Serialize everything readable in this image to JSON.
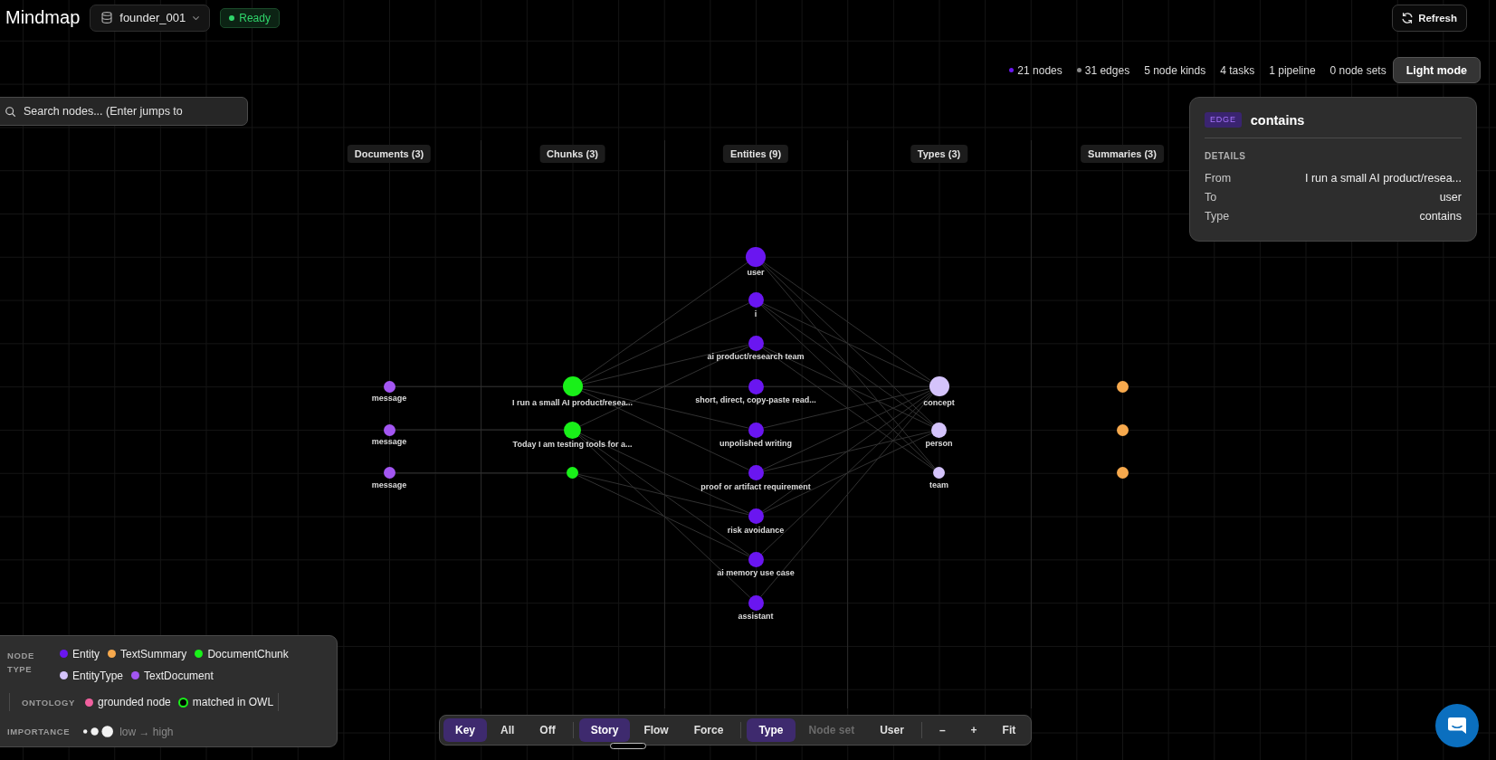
{
  "topbar": {
    "title": "Mindmap",
    "dataset": "founder_001",
    "status": "Ready",
    "refresh_button": "Refresh"
  },
  "stats": [
    {
      "text": "21 nodes",
      "color": "#6a16f0"
    },
    {
      "text": "31 edges",
      "color": "#8a8a8a"
    },
    {
      "text": "5 node kinds"
    },
    {
      "text": "4 tasks"
    },
    {
      "text": "1 pipeline"
    },
    {
      "text": "0 node sets"
    }
  ],
  "theme_button": "Light mode",
  "search": {
    "placeholder": "Search nodes... (Enter jumps to"
  },
  "edge_panel": {
    "tag": "EDGE",
    "title": "contains",
    "section": "DETAILS",
    "fields": [
      {
        "label": "From",
        "value": "I run a small AI product/resea..."
      },
      {
        "label": "To",
        "value": "user"
      },
      {
        "label": "Type",
        "value": "contains"
      }
    ]
  },
  "columns": [
    {
      "title": "Documents (3)",
      "kind": "document",
      "nodes": [
        {
          "label": "message",
          "kind": "small"
        },
        {
          "label": "message",
          "kind": "small"
        },
        {
          "label": "message",
          "kind": "small"
        }
      ]
    },
    {
      "title": "Chunks (3)",
      "kind": "chunk",
      "nodes": [
        {
          "label": "I run a small AI product/resea...",
          "kind": "large"
        },
        {
          "label": "Today I am testing tools for a...",
          "kind": "medium"
        },
        {
          "kind": "small"
        }
      ]
    },
    {
      "title": "Entities (9)",
      "kind": "entity",
      "nodes": [
        {
          "label": "user",
          "kind": "large"
        },
        {
          "label": "i",
          "kind": "regular"
        },
        {
          "label": "ai product/research team",
          "kind": "regular"
        },
        {
          "label": "short, direct, copy-paste read...",
          "kind": "regular"
        },
        {
          "label": "unpolished writing",
          "kind": "regular"
        },
        {
          "label": "proof or artifact requirement",
          "kind": "regular"
        },
        {
          "label": "risk avoidance",
          "kind": "regular"
        },
        {
          "label": "ai memory use case",
          "kind": "regular"
        },
        {
          "label": "assistant",
          "kind": "regular"
        }
      ]
    },
    {
      "title": "Types (3)",
      "kind": "type",
      "nodes": [
        {
          "label": "concept",
          "kind": "large"
        },
        {
          "label": "person",
          "kind": "regular"
        },
        {
          "label": "team",
          "kind": "small"
        }
      ]
    },
    {
      "title": "Summaries (3)",
      "kind": "summary",
      "nodes": [
        {
          "kind": "small"
        },
        {
          "kind": "small"
        },
        {
          "kind": "small"
        }
      ]
    }
  ],
  "legend": {
    "node_type_heading": "NODE TYPE",
    "node_types": [
      {
        "label": "Entity",
        "kind": "entity",
        "color": "#6a16f0"
      },
      {
        "label": "TextSummary",
        "kind": "summary",
        "color": "#f7a94d"
      },
      {
        "label": "DocumentChunk",
        "kind": "chunk",
        "color": "#19f019"
      },
      {
        "label": "EntityType",
        "kind": "type",
        "color": "#d4c3fb"
      },
      {
        "label": "TextDocument",
        "kind": "document",
        "color": "#a356f2"
      }
    ],
    "ontology_heading": "ONTOLOGY",
    "ontology": [
      {
        "label": "grounded node",
        "kind": "dot",
        "color": "#f0609e"
      },
      {
        "label": "matched in OWL",
        "kind": "ring",
        "color": "#19f019"
      }
    ],
    "importance_heading": "IMPORTANCE",
    "importance_caption": "low → high"
  },
  "toolbar": {
    "groups": [
      {
        "kind": "toggle",
        "buttons": [
          {
            "label": "Key",
            "selected": true,
            "disabled": false
          },
          {
            "label": "All",
            "selected": false,
            "disabled": false
          },
          {
            "label": "Off",
            "selected": false,
            "disabled": false
          }
        ]
      },
      {
        "kind": "toggle",
        "buttons": [
          {
            "label": "Story",
            "selected": true,
            "disabled": false
          },
          {
            "label": "Flow",
            "selected": false,
            "disabled": false
          },
          {
            "label": "Force",
            "selected": false,
            "disabled": false
          }
        ]
      },
      {
        "kind": "toggle",
        "buttons": [
          {
            "label": "Type",
            "selected": true,
            "disabled": false
          },
          {
            "label": "Node set",
            "selected": false,
            "disabled": true
          },
          {
            "label": "User",
            "selected": false,
            "disabled": false
          }
        ]
      },
      {
        "kind": "action",
        "buttons": [
          {
            "label": "–"
          },
          {
            "label": "+"
          },
          {
            "label": "Fit"
          }
        ]
      }
    ]
  }
}
